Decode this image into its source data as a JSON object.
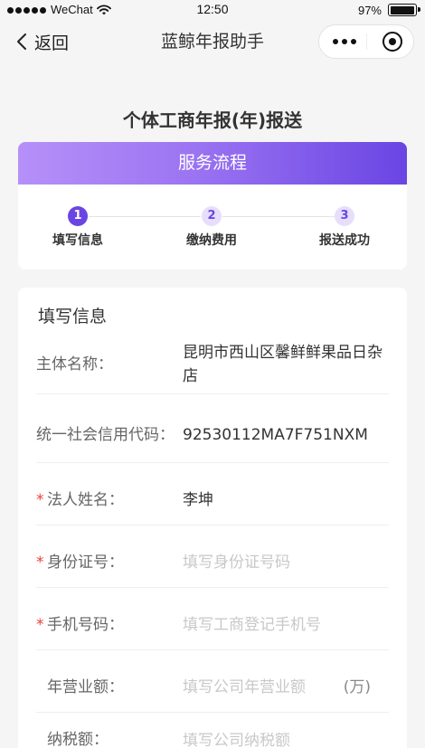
{
  "status_bar": {
    "signal_level": 5,
    "carrier": "WeChat",
    "time": "12:50",
    "battery": "97%"
  },
  "nav": {
    "back_label": "返回",
    "title": "蓝鲸年报助手"
  },
  "page_title": "个体工商年报(年)报送",
  "process": {
    "header": "服务流程",
    "current_step": 1,
    "steps": [
      {
        "number": "1",
        "label": "填写信息"
      },
      {
        "number": "2",
        "label": "缴纳费用"
      },
      {
        "number": "3",
        "label": "报送成功"
      }
    ]
  },
  "form": {
    "heading": "填写信息",
    "required_mark": "*",
    "fields": [
      {
        "label": "主体名称：",
        "value": "昆明市西山区馨鲜鲜果品日杂店",
        "required": false
      },
      {
        "label": "统一社会信用代码：",
        "value": "92530112MA7F751NXM",
        "required": false
      },
      {
        "label": "法人姓名：",
        "value": "李坤",
        "required": true
      },
      {
        "label": "身份证号：",
        "placeholder": "填写身份证号码",
        "required": true
      },
      {
        "label": "手机号码：",
        "placeholder": "填写工商登记手机号",
        "required": true
      },
      {
        "label": "年营业额：",
        "placeholder": "填写公司年营业额",
        "unit": "(万)",
        "required": false
      },
      {
        "label": "纳税额：",
        "placeholder": "填写公司纳税额",
        "required": false
      }
    ]
  },
  "icons": {
    "signal": "signal-strength-icon",
    "wifi": "wifi-icon",
    "battery": "battery-icon",
    "back": "chevron-left-icon",
    "more": "more-dots-icon",
    "close": "target-icon"
  },
  "colors": {
    "accent": "#6a45e3",
    "accent_light": "#e6defb",
    "header_gradient_start": "#b690f8",
    "header_gradient_end": "#6a45e3",
    "required": "#e5413a",
    "page_background": "#f5f5f5"
  }
}
